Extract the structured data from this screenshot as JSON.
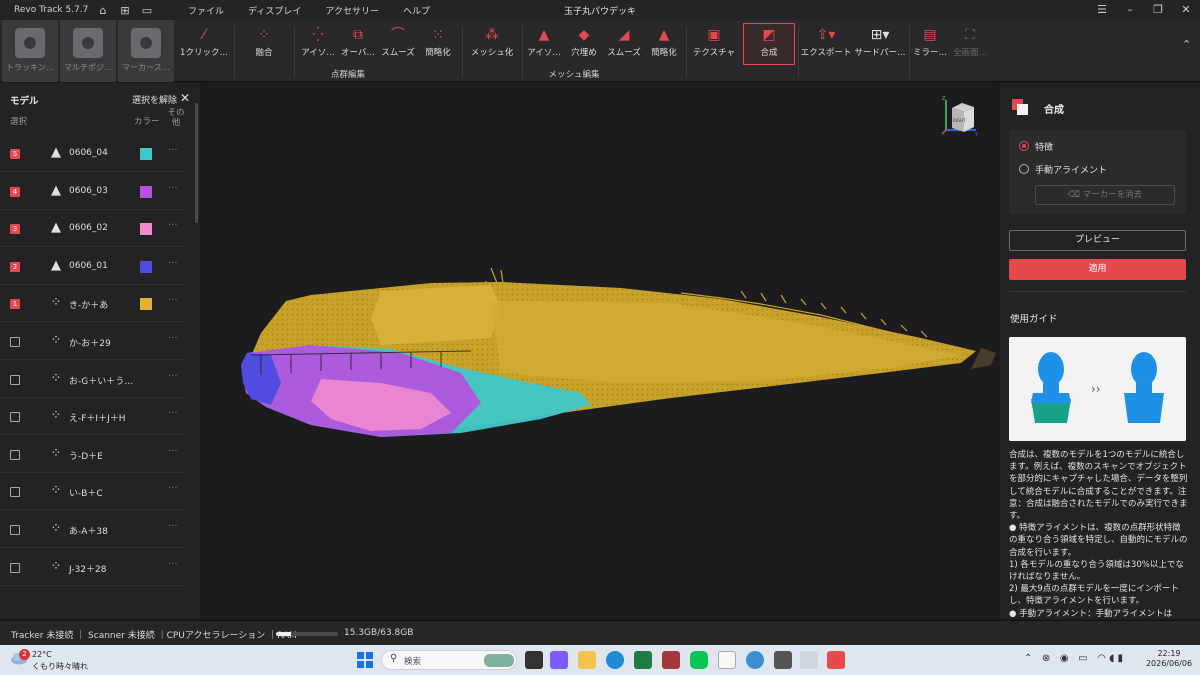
{
  "app": {
    "name": "Revo Track 5.7.7",
    "window_title": "玉子丸パウデッキ",
    "menu": [
      "ファイル",
      "ディスプレイ",
      "アクセサリー",
      "ヘルプ"
    ]
  },
  "toolbar": {
    "modes": [
      "トラッキン…",
      "マルチポジ…",
      "マーカース…"
    ],
    "tools": {
      "one_click": "1クリック…",
      "fusion": "融合",
      "isolate": "アイソ…",
      "overlap": "オーバ…",
      "smooth": "スムーズ",
      "simplify": "簡略化",
      "meshing": "メッシュ化",
      "mesh_isolate": "アイソ…",
      "fill_holes": "穴埋め",
      "mesh_smooth": "スムーズ",
      "mesh_simplify": "簡略化",
      "texture": "テクスチャ",
      "merge": "合成",
      "export": "エクスポート",
      "third_party": "サードパー…",
      "mirror": "ミラー…",
      "fullscreen": "全画面…"
    },
    "groups": {
      "point_cloud_edit": "点群編集",
      "mesh_edit": "メッシュ編集"
    }
  },
  "models_panel": {
    "title": "モデル",
    "deselect": "選択を解除",
    "col_select": "選択",
    "col_color": "カラー",
    "col_other": "その他",
    "rows": [
      {
        "sel": "5",
        "name": "0606_04",
        "kind": "mesh",
        "color": "#3fc7c9"
      },
      {
        "sel": "4",
        "name": "0606_03",
        "kind": "mesh",
        "color": "#b84fe0"
      },
      {
        "sel": "3",
        "name": "0606_02",
        "kind": "mesh",
        "color": "#ef8ad0"
      },
      {
        "sel": "2",
        "name": "0606_01",
        "kind": "mesh",
        "color": "#4d4de0"
      },
      {
        "sel": "1",
        "name": "き-か＋あ",
        "kind": "points",
        "color": "#e3b330"
      },
      {
        "sel": "",
        "name": "か-お＋29",
        "kind": "points",
        "color": ""
      },
      {
        "sel": "",
        "name": "お-G＋い＋う…",
        "kind": "points",
        "color": ""
      },
      {
        "sel": "",
        "name": "え-F＋I＋J＋H",
        "kind": "points",
        "color": ""
      },
      {
        "sel": "",
        "name": "う-D＋E",
        "kind": "points",
        "color": ""
      },
      {
        "sel": "",
        "name": "い-B＋C",
        "kind": "points",
        "color": ""
      },
      {
        "sel": "",
        "name": "あ-A＋38",
        "kind": "points",
        "color": ""
      },
      {
        "sel": "",
        "name": "J-32＋28",
        "kind": "points",
        "color": ""
      }
    ]
  },
  "viewport": {
    "cube_label": "RIGHT",
    "axis_z": "Z",
    "axis_y": "Y"
  },
  "merge_panel": {
    "title": "合成",
    "option_feature": "特徴",
    "option_manual": "手動アライメント",
    "erase_markers": "マーカーを消去",
    "preview": "プレビュー",
    "apply": "適用",
    "guide_title": "使用ガイド",
    "guide_paragraphs": [
      "合成は、複数のモデルを1つのモデルに統合します。例えば、複数のスキャンでオブジェクトを部分的にキャプチャした場合、データを整列して統合モデルに合成することができます。注意：合成は融合されたモデルでのみ実行できます。",
      "● 特徴アライメントは、複数の点群形状特徴の重なり合う領域を特定し、自動的にモデルの合成を行います。",
      "1) 各モデルの重なり合う領域は30%以上でなければなりません。",
      "2) 最大9点の点群モデルを一度にインポートし、特徴アライメントを行います。",
      "● 手動アライメント：手動アライメントは"
    ]
  },
  "status": {
    "text": "Tracker 未接続 ｜ Scanner 未接続 ｜CPUアクセラレーション ｜RAM",
    "ram": "15.3GB/63.8GB",
    "ram_fraction": 0.24
  },
  "taskbar": {
    "weather_badge": "2",
    "temperature": "22°C",
    "condition": "くもり時々晴れ",
    "search_placeholder": "検索",
    "time": "22:19",
    "date": "2026/06/06"
  },
  "colors": {
    "accent": "#e5484d",
    "hull_yellow": "#c9a22a"
  }
}
